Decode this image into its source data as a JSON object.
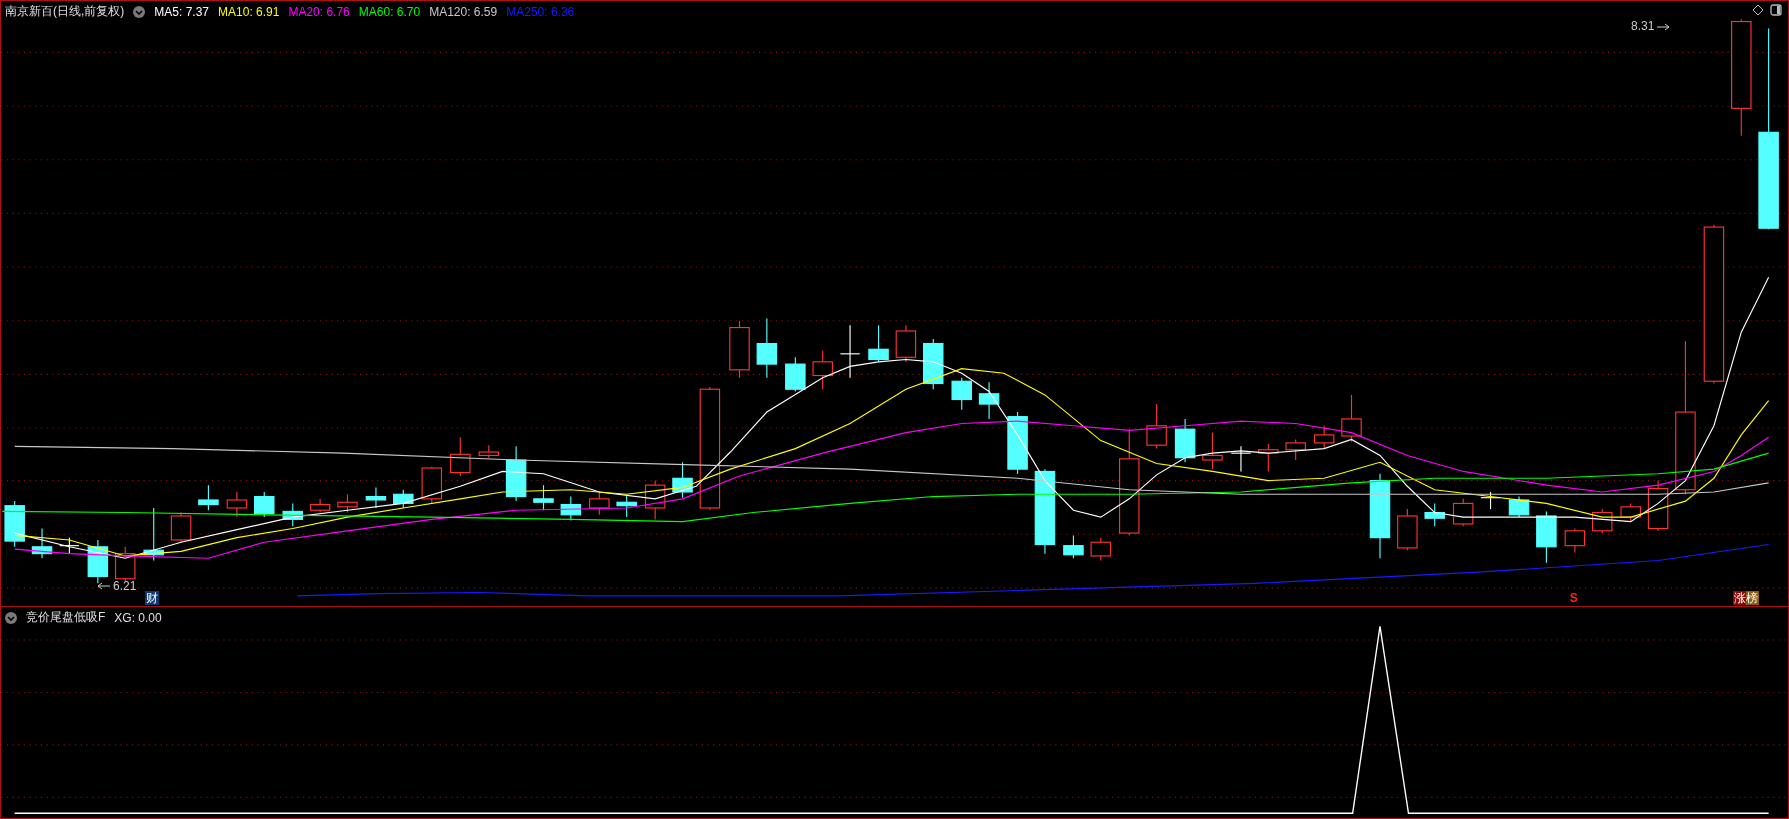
{
  "title": "南京新百(日线,前复权)",
  "ma_legend": [
    {
      "label": "MA5:",
      "value": "7.37",
      "color": "#ffffff"
    },
    {
      "label": "MA10:",
      "value": "6.91",
      "color": "#ffff00"
    },
    {
      "label": "MA20:",
      "value": "6.76",
      "color": "#ff00ff"
    },
    {
      "label": "MA60:",
      "value": "6.70",
      "color": "#00ff00"
    },
    {
      "label": "MA120:",
      "value": "6.59",
      "color": "#c8c8c8"
    },
    {
      "label": "MA250:",
      "value": "6.36",
      "color": "#1a1aff"
    }
  ],
  "price_chart": {
    "low_label": "6.21",
    "high_label": "8.31",
    "badges": [
      {
        "kind": "finance",
        "text": "财"
      },
      {
        "kind": "signal",
        "text": "S"
      },
      {
        "kind": "rank",
        "text": "涨榜"
      }
    ]
  },
  "indicator": {
    "name": "竞价尾盘低吸F",
    "reading": "XG: 0.00"
  }
}
